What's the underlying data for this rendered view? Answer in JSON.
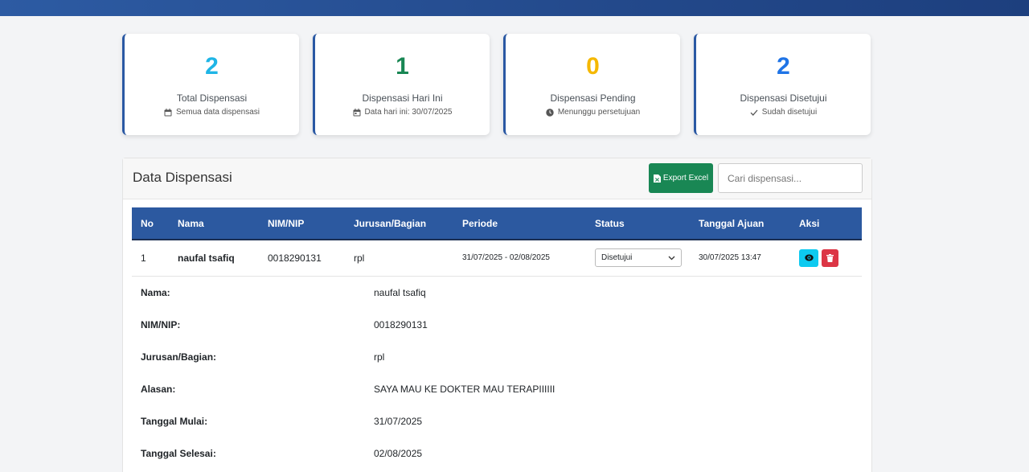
{
  "colors": {
    "topbar": "#23498b",
    "total": "#1fb5e6",
    "today": "#198754",
    "pending": "#f5b800",
    "approved": "#1f74e6",
    "header_row": "#2c59a0",
    "export": "#198754",
    "view": "#0dcaf0",
    "delete": "#dc3545"
  },
  "stats": [
    {
      "value": "2",
      "title": "Total Dispensasi",
      "subtitle": "Semua data dispensasi",
      "icon": "calendar-icon"
    },
    {
      "value": "1",
      "title": "Dispensasi Hari Ini",
      "subtitle": "Data hari ini: 30/07/2025",
      "icon": "calendar-day-icon"
    },
    {
      "value": "0",
      "title": "Dispensasi Pending",
      "subtitle": "Menunggu persetujuan",
      "icon": "clock-icon"
    },
    {
      "value": "2",
      "title": "Dispensasi Disetujui",
      "subtitle": "Sudah disetujui",
      "icon": "check-icon"
    }
  ],
  "panel": {
    "title": "Data Dispensasi",
    "export_label": "Export Excel",
    "search_placeholder": "Cari dispensasi..."
  },
  "table": {
    "headers": [
      "No",
      "Nama",
      "NIM/NIP",
      "Jurusan/Bagian",
      "Periode",
      "Status",
      "Tanggal Ajuan",
      "Aksi"
    ],
    "rows": [
      {
        "no": "1",
        "nama": "naufal tsafiq",
        "nim": "0018290131",
        "jurusan": "rpl",
        "periode": "31/07/2025 - 02/08/2025",
        "status": "Disetujui",
        "tanggal": "30/07/2025 13:47"
      }
    ]
  },
  "detail": [
    {
      "label": "Nama:",
      "value": "naufal tsafiq"
    },
    {
      "label": "NIM/NIP:",
      "value": "0018290131"
    },
    {
      "label": "Jurusan/Bagian:",
      "value": "rpl"
    },
    {
      "label": "Alasan:",
      "value": "SAYA MAU KE DOKTER MAU TERAPIIIIII"
    },
    {
      "label": "Tanggal Mulai:",
      "value": "31/07/2025"
    },
    {
      "label": "Tanggal Selesai:",
      "value": "02/08/2025"
    }
  ]
}
